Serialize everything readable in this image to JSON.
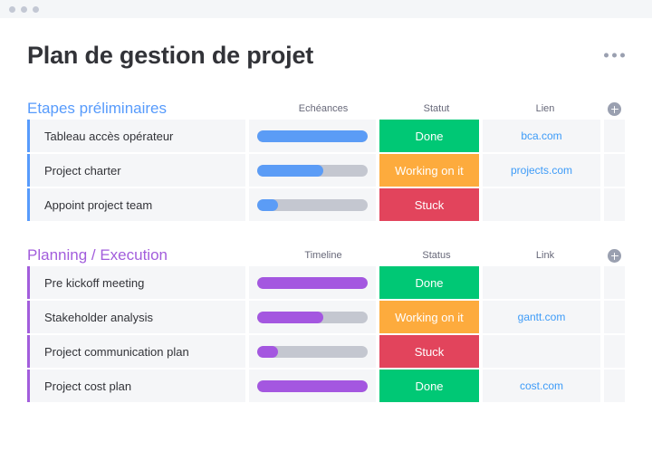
{
  "window": {
    "dots": [
      "window-dot-1",
      "window-dot-2",
      "window-dot-3"
    ]
  },
  "header": {
    "title": "Plan de gestion de projet",
    "more_menu_label": "…"
  },
  "colors": {
    "group_blue": "#579bfc",
    "group_purple": "#a25ddc",
    "status_done": "#00c875",
    "status_working": "#fdab3d",
    "status_stuck": "#e2445c",
    "link": "#3d9bf8",
    "bar_track": "#c4c7d0",
    "cell_bg": "#f5f6f8",
    "text": "#323338",
    "muted_text": "#676879"
  },
  "groups": [
    {
      "title": "Etapes préliminaires",
      "accent": "blue",
      "columns": {
        "timeline": "Echéances",
        "status": "Statut",
        "link": "Lien",
        "add": "+"
      },
      "rows": [
        {
          "name": "Tableau accès opérateur",
          "progress": 100,
          "status": "Done",
          "status_kind": "done",
          "link": "bca.com"
        },
        {
          "name": "Project charter",
          "progress": 60,
          "status": "Working on it",
          "status_kind": "working",
          "link": "projects.com"
        },
        {
          "name": "Appoint project team",
          "progress": 19,
          "status": "Stuck",
          "status_kind": "stuck",
          "link": ""
        }
      ]
    },
    {
      "title": "Planning / Execution",
      "accent": "purple",
      "columns": {
        "timeline": "Timeline",
        "status": "Status",
        "link": "Link",
        "add": "+"
      },
      "rows": [
        {
          "name": "Pre kickoff meeting",
          "progress": 100,
          "status": "Done",
          "status_kind": "done",
          "link": ""
        },
        {
          "name": "Stakeholder analysis",
          "progress": 60,
          "status": "Working on it",
          "status_kind": "working",
          "link": "gantt.com"
        },
        {
          "name": "Project communication plan",
          "progress": 19,
          "status": "Stuck",
          "status_kind": "stuck",
          "link": ""
        },
        {
          "name": "Project cost plan",
          "progress": 100,
          "status": "Done",
          "status_kind": "done",
          "link": "cost.com"
        }
      ]
    }
  ]
}
